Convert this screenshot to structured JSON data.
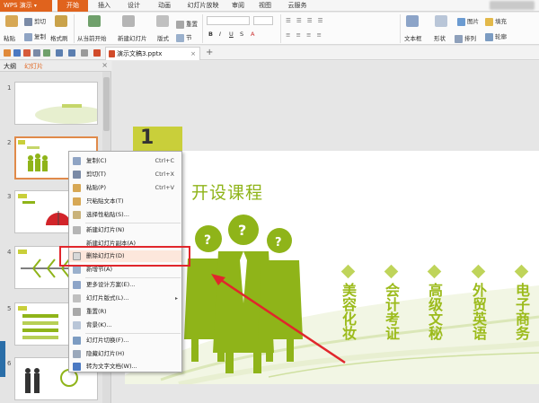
{
  "app": {
    "name": "WPS 演示"
  },
  "tabs": [
    "开始",
    "插入",
    "设计",
    "动画",
    "幻灯片放映",
    "审阅",
    "视图",
    "云服务"
  ],
  "ribbon": {
    "paste": "粘贴",
    "cut": "剪切",
    "copy": "复制",
    "format_painter": "格式刷",
    "from_current": "从当前开始",
    "new_slide": "新建幻灯片",
    "layout": "版式",
    "section": "节",
    "reset": "重置",
    "textbox": "文本框",
    "shape": "形状",
    "arrange": "排列",
    "picture": "图片",
    "fill": "填充",
    "outline": "轮廓"
  },
  "document": {
    "tab_name": "演示文稿3.pptx"
  },
  "panel": {
    "outline_tab": "大纲",
    "slides_tab": "幻灯片",
    "slide_numbers": [
      "1",
      "2",
      "3",
      "4",
      "5",
      "6"
    ]
  },
  "slide": {
    "badge": "1",
    "title": "开设课程",
    "courses": [
      "美容化妆",
      "会计考证",
      "高级文秘",
      "外贸英语",
      "电子商务"
    ],
    "colors": {
      "accent": "#9cbb1c",
      "badge": "#c9cf3a"
    }
  },
  "context_menu": {
    "items": [
      {
        "label": "复制(C)",
        "shortcut": "Ctrl+C"
      },
      {
        "label": "剪切(T)",
        "shortcut": "Ctrl+X"
      },
      {
        "label": "粘贴(P)",
        "shortcut": "Ctrl+V"
      },
      {
        "label": "只粘贴文本(T)",
        "shortcut": ""
      },
      {
        "label": "选择性粘贴(S)...",
        "shortcut": ""
      },
      {
        "label": "新建幻灯片(N)",
        "shortcut": ""
      },
      {
        "label": "新建幻灯片副本(A)",
        "shortcut": ""
      },
      {
        "label": "删除幻灯片(D)",
        "shortcut": ""
      },
      {
        "label": "新增节(A)",
        "shortcut": ""
      },
      {
        "label": "更多设计方案(E)...",
        "shortcut": ""
      },
      {
        "label": "幻灯片版式(L)...",
        "shortcut": ""
      },
      {
        "label": "重置(R)",
        "shortcut": ""
      },
      {
        "label": "背景(K)...",
        "shortcut": ""
      },
      {
        "label": "幻灯片切换(F)...",
        "shortcut": ""
      },
      {
        "label": "隐藏幻灯片(H)",
        "shortcut": ""
      },
      {
        "label": "转为文字文档(W)...",
        "shortcut": ""
      }
    ],
    "highlighted_index": 7,
    "highlight_color": "#e1262c"
  }
}
